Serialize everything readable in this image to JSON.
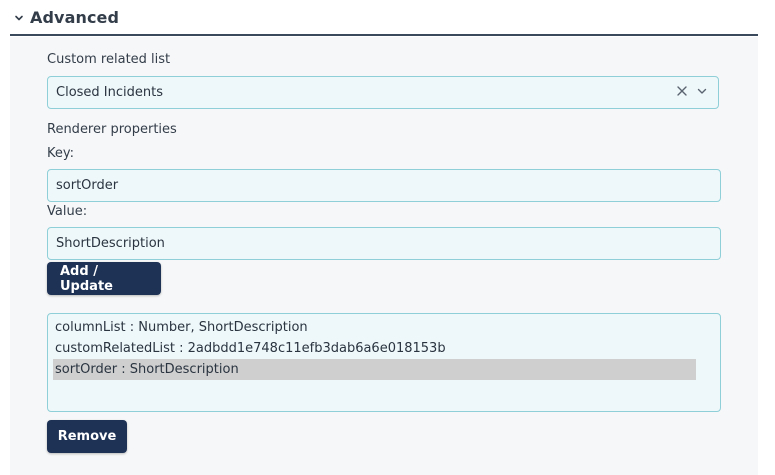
{
  "section": {
    "title": "Advanced",
    "expanded_icon": "chevron-down-icon"
  },
  "custom_related_list": {
    "label": "Custom related list",
    "selected_value": "Closed Incidents",
    "clear_icon": "close-icon",
    "dropdown_icon": "chevron-down-icon"
  },
  "renderer_properties": {
    "label": "Renderer properties",
    "key_label": "Key:",
    "key_value": "sortOrder",
    "value_label": "Value:",
    "value_value": "ShortDescription",
    "add_update_label": "Add / Update",
    "properties": [
      {
        "text": "columnList : Number, ShortDescription",
        "selected": false
      },
      {
        "text": "customRelatedList : 2adbdd1e748c11efb3dab6a6e018153b",
        "selected": false
      },
      {
        "text": "sortOrder : ShortDescription",
        "selected": true
      }
    ],
    "remove_label": "Remove"
  },
  "colors": {
    "button_bg": "#1e3256",
    "field_bg": "#eef8fa",
    "field_border": "#8fcfd8",
    "selected_row_bg": "#cfcfcf",
    "header_rule": "#3a4a5c"
  }
}
